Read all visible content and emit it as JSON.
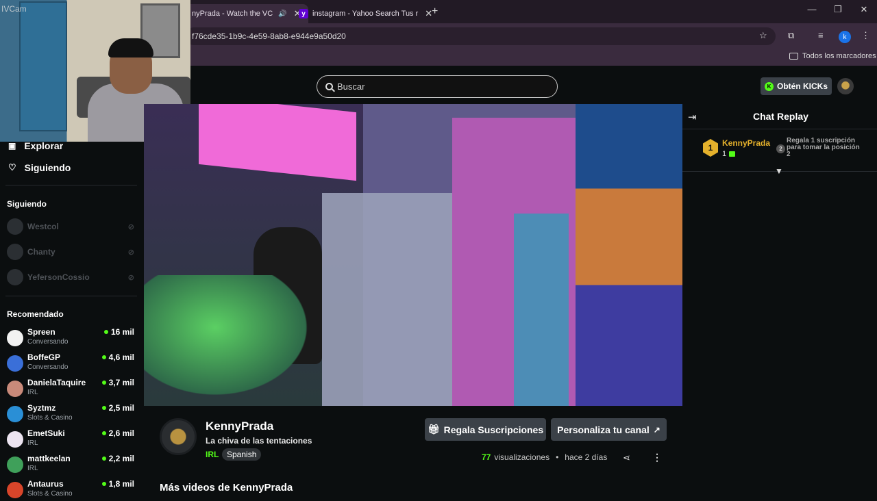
{
  "browser": {
    "tabs": [
      {
        "label": "nyPrada - Watch the VC",
        "active": true
      },
      {
        "label": "instagram - Yahoo Search Tus r",
        "active": false
      }
    ],
    "url": "f76cde35-1b9c-4e59-8ab8-e944e9a50d20",
    "profile_initial": "k",
    "bookmarks_label": "Todos los marcadores"
  },
  "webcam": {
    "label": "IVCam"
  },
  "header": {
    "search_placeholder": "Buscar",
    "kicks_label": "Obtén KICKs"
  },
  "sidebar": {
    "nav": [
      {
        "label": "Explorar",
        "icon": "compass-icon"
      },
      {
        "label": "Siguiendo",
        "icon": "heart-icon"
      }
    ],
    "following_heading": "Siguiendo",
    "following": [
      {
        "name": "Westcol"
      },
      {
        "name": "Chanty"
      },
      {
        "name": "YefersonCossio"
      }
    ],
    "recommended_heading": "Recomendado",
    "recommended": [
      {
        "name": "Spreen",
        "category": "Conversando",
        "viewers": "16 mil",
        "color": "#f2f2f2"
      },
      {
        "name": "BoffeGP",
        "category": "Conversando",
        "viewers": "4,6 mil",
        "color": "#3a6fd8"
      },
      {
        "name": "DanielaTaquire",
        "category": "IRL",
        "viewers": "3,7 mil",
        "color": "#c98a7a"
      },
      {
        "name": "Syztmz",
        "category": "Slots & Casino",
        "viewers": "2,5 mil",
        "color": "#2a8fd6"
      },
      {
        "name": "EmetSuki",
        "category": "IRL",
        "viewers": "2,6 mil",
        "color": "#ece4f0"
      },
      {
        "name": "mattkeelan",
        "category": "IRL",
        "viewers": "2,2 mil",
        "color": "#3fa05a"
      },
      {
        "name": "Antaurus",
        "category": "Slots & Casino",
        "viewers": "1,8 mil",
        "color": "#d8452a"
      }
    ]
  },
  "channel": {
    "name": "KennyPrada",
    "title": "La chiva de las tentaciones",
    "category": "IRL",
    "language": "Spanish",
    "gift_button": "Regala Suscripciones",
    "customize_button": "Personaliza tu canal",
    "views_count": "77",
    "views_label": "visualizaciones",
    "separator": "•",
    "time_ago": "hace 2 días",
    "more_videos": "Más videos de KennyPrada"
  },
  "chat": {
    "title": "Chat Replay",
    "top_gifter": {
      "rank": "1",
      "name": "KennyPrada",
      "count": "1"
    },
    "next_slot": {
      "rank": "2",
      "text": "Regala 1 suscripción para tomar la posición 2"
    }
  },
  "colors": {
    "accent": "#53fc18",
    "gold": "#e5b12c",
    "bg": "#0b0e0f",
    "button": "#3b4148"
  }
}
